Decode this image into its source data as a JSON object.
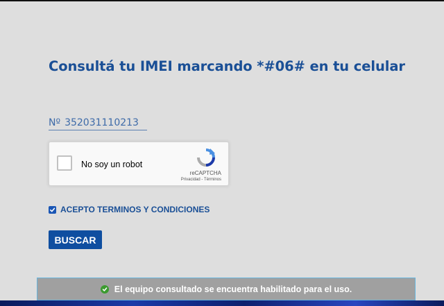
{
  "page": {
    "title": "Consultá tu IMEI marcando *#06# en tu celular"
  },
  "imei": {
    "prefix": "Nº",
    "value": "352031110213"
  },
  "recaptcha": {
    "label": "No soy un robot",
    "brand": "reCAPTCHA",
    "links": "Privacidad - Términos",
    "icon": "recaptcha-logo-icon"
  },
  "terms": {
    "label": "ACEPTO TERMINOS Y CONDICIONES",
    "checked": true
  },
  "search": {
    "button_label": "BUSCAR"
  },
  "status": {
    "message": "El equipo consultado se encuentra habilitado para el uso.",
    "icon": "check-circle-icon",
    "color": "#3b9b2f"
  },
  "colors": {
    "background": "#dedede",
    "title": "#1a4f96",
    "button": "#0f4ea0",
    "banner": "#a0a0a0"
  }
}
